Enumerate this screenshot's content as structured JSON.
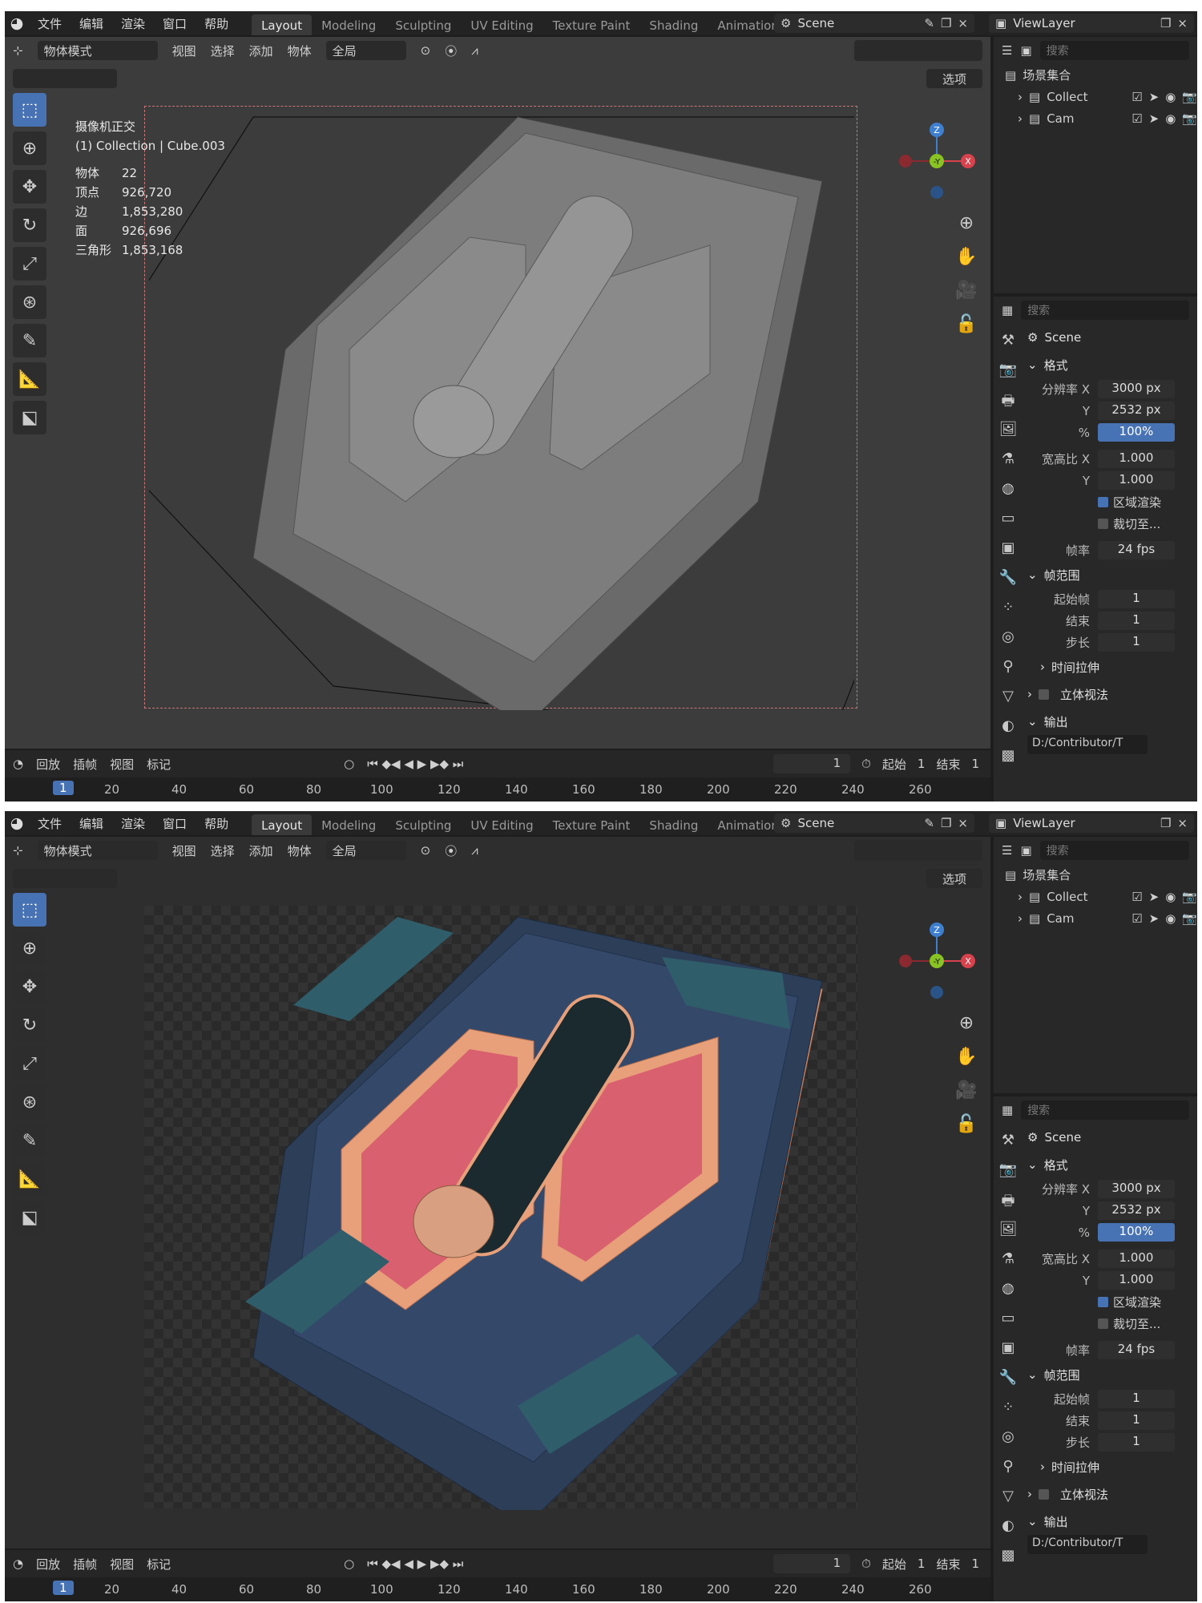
{
  "app": {
    "menus": [
      "文件",
      "编辑",
      "渲染",
      "窗口",
      "帮助"
    ],
    "workspaces": [
      "Layout",
      "Modeling",
      "Sculpting",
      "UV Editing",
      "Texture Paint",
      "Shading",
      "Animation"
    ],
    "scene_name": "Scene",
    "view_layer": "ViewLayer"
  },
  "viewport": {
    "mode": "物体模式",
    "menus": [
      "视图",
      "选择",
      "添加",
      "物体"
    ],
    "transform_orientation": "全局",
    "options_label": "选项",
    "overlay": {
      "view_name": "摄像机正交",
      "collection_line": "(1) Collection | Cube.003",
      "stats": [
        {
          "k": "物体",
          "v": "22"
        },
        {
          "k": "顶点",
          "v": "926,720"
        },
        {
          "k": "边",
          "v": "1,853,280"
        },
        {
          "k": "面",
          "v": "926,696"
        },
        {
          "k": "三角形",
          "v": "1,853,168"
        }
      ]
    },
    "gizmo": {
      "z": "Z",
      "y": "-Y",
      "x": "X"
    }
  },
  "timeline": {
    "menus": [
      "回放",
      "插帧",
      "视图",
      "标记"
    ],
    "current_frame": "1",
    "start_label": "起始",
    "start_value": "1",
    "end_label": "结束",
    "end_value": "1",
    "ruler": [
      "20",
      "40",
      "60",
      "80",
      "100",
      "120",
      "140",
      "160",
      "180",
      "200",
      "220",
      "240",
      "260"
    ]
  },
  "outliner": {
    "search_placeholder": "搜索",
    "root": "场景集合",
    "items": [
      "Collect",
      "Cam"
    ]
  },
  "properties": {
    "search_placeholder": "搜索",
    "scene": "Scene",
    "format_title": "格式",
    "res_x_label": "分辨率 X",
    "res_x": "3000 px",
    "res_y_label": "Y",
    "res_y": "2532 px",
    "pct_label": "%",
    "pct": "100%",
    "aspect_x_label": "宽高比 X",
    "aspect_x": "1.000",
    "aspect_y_label": "Y",
    "aspect_y": "1.000",
    "region_render": "区域渲染",
    "crop": "裁切至...",
    "fps_label": "帧率",
    "fps": "24 fps",
    "frame_range_title": "帧范围",
    "start_label": "起始帧",
    "start": "1",
    "end_label": "结束",
    "end": "1",
    "step_label": "步长",
    "step": "1",
    "time_stretch": "时间拉伸",
    "stereo": "立体视法",
    "output_title": "输出",
    "output_path": "D:/Contributor/T"
  },
  "colors": {
    "accent": "#4772b3",
    "gizmo_x": "#d7424c",
    "gizmo_y": "#88c223",
    "gizmo_z": "#3f7fd0",
    "model_gray": "#7a7a7a",
    "body_navy": "#2c3e58",
    "trim_teal": "#2f5d6a",
    "panel_pink": "#d9606e",
    "frame_copper": "#e8a07a"
  }
}
